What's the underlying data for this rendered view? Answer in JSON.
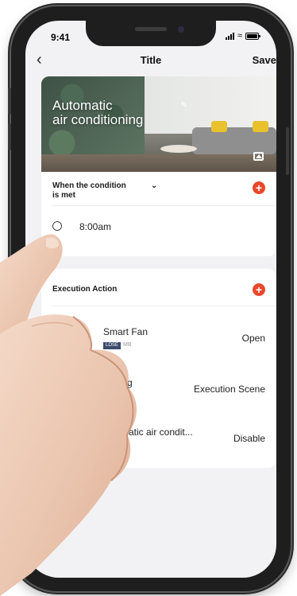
{
  "status_bar": {
    "time": "9:41"
  },
  "nav": {
    "back_icon": "chevron-left-icon",
    "title": "Title",
    "save_label": "Save"
  },
  "hero": {
    "title_line1": "Automatic",
    "title_line2": "air conditioning",
    "edit_icon": "pencil-icon",
    "image_icon": "image-icon"
  },
  "condition": {
    "section_title_line1": "When the condition",
    "section_title_line2": "is met",
    "time": "8:00am"
  },
  "execution": {
    "section_title": "Execution Action",
    "items": [
      {
        "name": "Smart Fan",
        "tag": "LOSE",
        "sub": "MB",
        "value": "Open"
      },
      {
        "name": "bing",
        "sub": "l",
        "value": "Execution Scene"
      },
      {
        "name": "matic air condit...",
        "sub": "tic",
        "value": "Disable"
      }
    ]
  },
  "colors": {
    "accent": "#e8482c",
    "background": "#f2f2f4",
    "card": "#ffffff",
    "frame": "#1e1e1e"
  }
}
